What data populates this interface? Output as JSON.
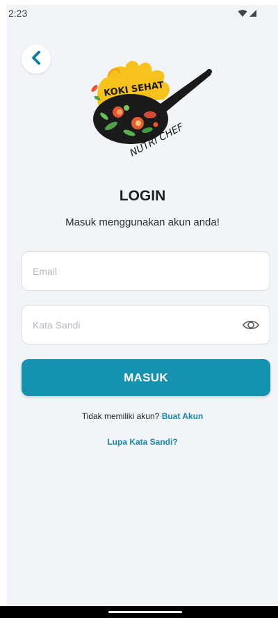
{
  "status_bar": {
    "time": "2:23",
    "wifi_icon": "wifi-icon",
    "signal_icon": "signal-icon"
  },
  "back": {
    "icon": "chevron-left-icon",
    "accent": "#0e7f9c"
  },
  "logo": {
    "brand_top": "KOKI SEHAT",
    "brand_bottom": "NUTRI CHEF",
    "flame_color": "#f7c21b"
  },
  "login": {
    "title": "LOGIN",
    "subtitle": "Masuk menggunakan akun anda!",
    "email_placeholder": "Email",
    "password_placeholder": "Kata Sandi",
    "eye_icon": "eye-icon",
    "submit_label": "MASUK",
    "no_account_text": "Tidak memiliki akun?",
    "signup_link": "Buat Akun",
    "forgot_link": "Lupa Kata Sandi?"
  },
  "colors": {
    "primary": "#1591b2",
    "link": "#1a86ae",
    "background": "#f1f5fa"
  }
}
